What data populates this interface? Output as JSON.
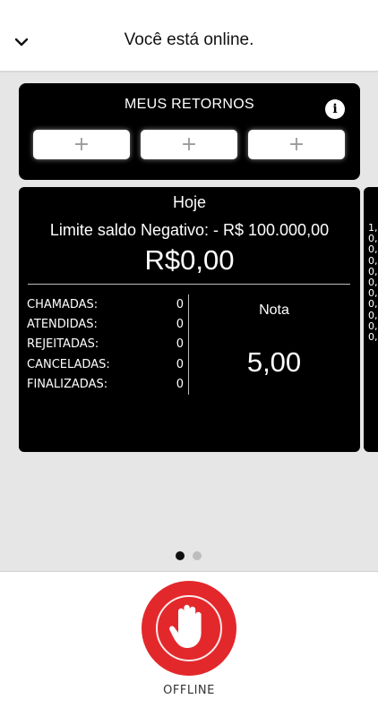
{
  "header": {
    "title": "Você está online.",
    "back_icon": "chevron-down-icon"
  },
  "returns": {
    "title": "MEUS RETORNOS",
    "info_icon": "info-icon",
    "slots": [
      {
        "label": "+"
      },
      {
        "label": "+"
      },
      {
        "label": "+"
      }
    ]
  },
  "card": {
    "period": "Hoje",
    "limit": "Limite saldo Negativo: - R$ 100.000,00",
    "balance": "R$0,00",
    "stats": [
      {
        "label": "CHAMADAS:",
        "value": "0"
      },
      {
        "label": "ATENDIDAS:",
        "value": "0"
      },
      {
        "label": "REJEITADAS:",
        "value": "0"
      },
      {
        "label": "CANCELADAS:",
        "value": "0"
      },
      {
        "label": "FINALIZADAS:",
        "value": "0"
      }
    ],
    "rating_label": "Nota",
    "rating_value": "5,00"
  },
  "peek_card": {
    "values": [
      "1,",
      "0,",
      "0,",
      "0,",
      "0,",
      "0,",
      "0,",
      "0,",
      "0,",
      "0,",
      "0,"
    ]
  },
  "pager": {
    "active_index": 0,
    "count": 2,
    "active_color": "#111111",
    "inactive_color": "#bdbdbd"
  },
  "offline_button": {
    "label": "OFFLINE",
    "icon": "hand-stop-icon",
    "color": "#e3282c"
  }
}
